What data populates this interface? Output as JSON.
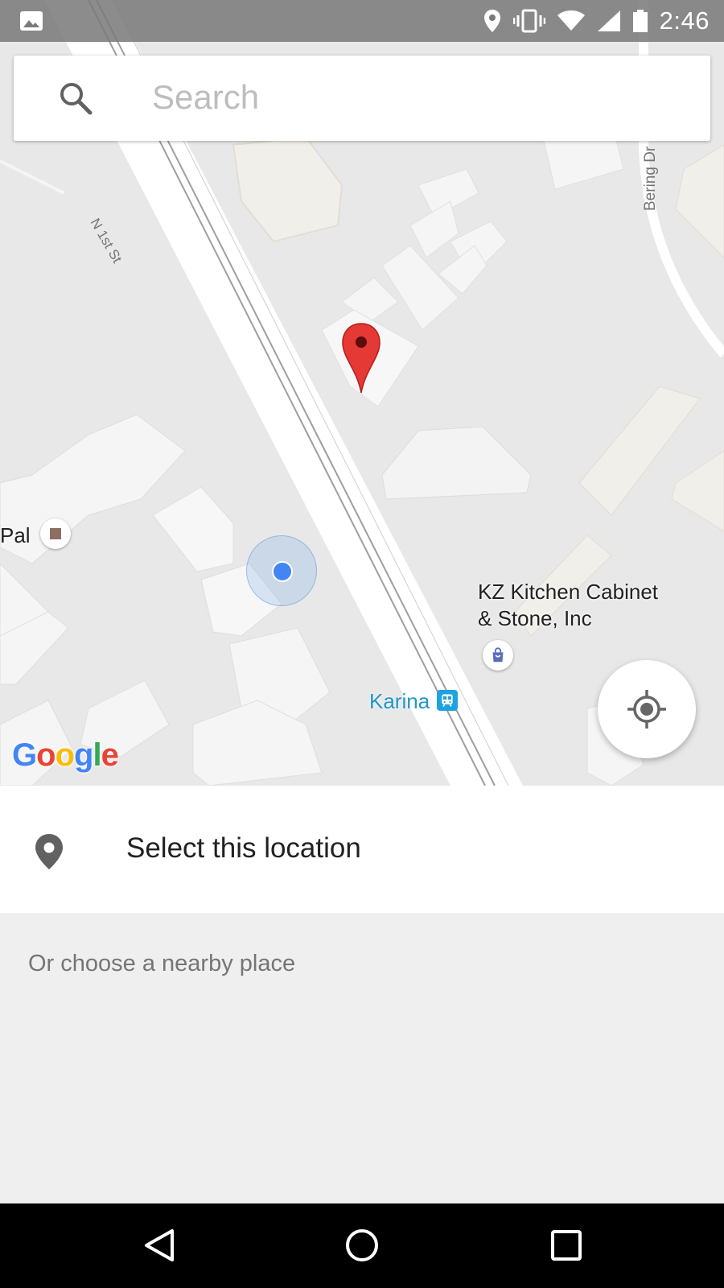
{
  "status_bar": {
    "time": "2:46",
    "icons": [
      "image-icon",
      "location-icon",
      "vibrate-icon",
      "wifi-icon",
      "signal-icon",
      "battery-icon"
    ]
  },
  "search": {
    "placeholder": "Search",
    "value": ""
  },
  "map": {
    "street_labels": {
      "n1st": "N 1st St",
      "bering": "Bering Dr"
    },
    "places": {
      "pal": "Pal",
      "kz_line1": "KZ Kitchen Cabinet",
      "kz_line2": "& Stone, Inc",
      "karina": "Karina"
    },
    "logo": "Google",
    "logo_colors": [
      "#4285F4",
      "#EA4335",
      "#FBBC05",
      "#4285F4",
      "#34A853",
      "#EA4335"
    ],
    "pin_color": "#E53935",
    "my_location_color": "#4285F4"
  },
  "select_location": {
    "label": "Select this location"
  },
  "nearby": {
    "label": "Or choose a nearby place"
  },
  "nav_bar": {
    "icons": [
      "back-icon",
      "home-icon",
      "recents-icon"
    ]
  }
}
